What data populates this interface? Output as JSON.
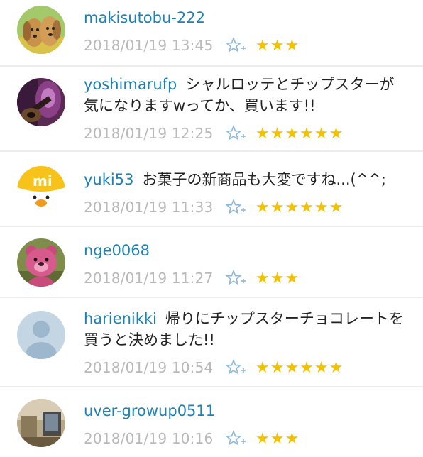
{
  "comments": [
    {
      "username": "makisutobu-222",
      "text": "",
      "timestamp": "2018/01/19 13:45",
      "stars": "★★★",
      "star_count": 3,
      "avatar": "dog-photo-avatar"
    },
    {
      "username": "yoshimarufp",
      "text": "シャルロッテとチップスターが気になりますwってか、買います!!",
      "timestamp": "2018/01/19 12:25",
      "stars": "★★★★★★",
      "star_count": 6,
      "avatar": "guitar-photo-avatar"
    },
    {
      "username": "yuki53",
      "text": "お菓子の新商品も大変ですね...(^^;",
      "timestamp": "2018/01/19 11:33",
      "stars": "★★★★★★",
      "star_count": 6,
      "avatar": "mi-duck-avatar"
    },
    {
      "username": "nge0068",
      "text": "",
      "timestamp": "2018/01/19 11:27",
      "stars": "★★★",
      "star_count": 3,
      "avatar": "bear-toy-avatar"
    },
    {
      "username": "harienikki",
      "text": "帰りにチップスターチョコレートを買うと決めました!!",
      "timestamp": "2018/01/19 10:54",
      "stars": "★★★★★★",
      "star_count": 6,
      "avatar": "default-user-avatar"
    },
    {
      "username": "uver-growup0511",
      "text": "",
      "timestamp": "2018/01/19 10:16",
      "stars": "★★★",
      "star_count": 3,
      "avatar": "room-photo-avatar"
    }
  ],
  "colors": {
    "username": "#1b82b8",
    "timestamp": "#b9b9b9",
    "stars": "#f2c200",
    "star_add_icon": "#8fb8d8",
    "divider": "#ececec"
  }
}
